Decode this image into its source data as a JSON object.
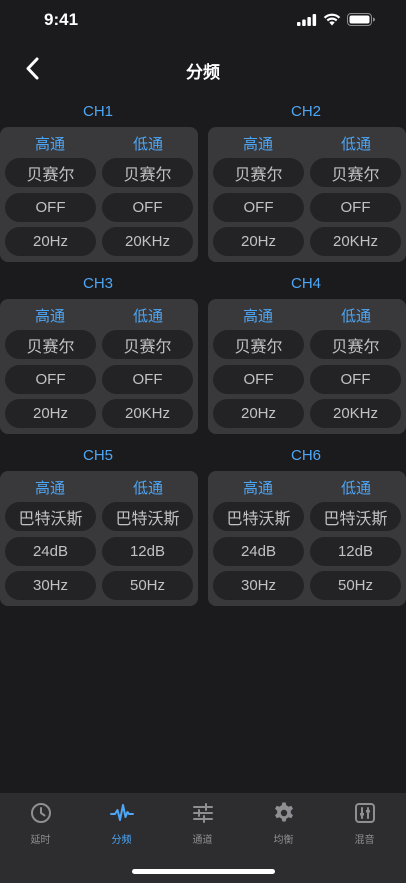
{
  "status": {
    "time": "9:41"
  },
  "header": {
    "title": "分频"
  },
  "columns": {
    "high": "高通",
    "low": "低通"
  },
  "channels": [
    {
      "name": "CH1",
      "high": {
        "type": "贝赛尔",
        "slope": "OFF",
        "freq": "20Hz"
      },
      "low": {
        "type": "贝赛尔",
        "slope": "OFF",
        "freq": "20KHz"
      }
    },
    {
      "name": "CH2",
      "high": {
        "type": "贝赛尔",
        "slope": "OFF",
        "freq": "20Hz"
      },
      "low": {
        "type": "贝赛尔",
        "slope": "OFF",
        "freq": "20KHz"
      }
    },
    {
      "name": "CH3",
      "high": {
        "type": "贝赛尔",
        "slope": "OFF",
        "freq": "20Hz"
      },
      "low": {
        "type": "贝赛尔",
        "slope": "OFF",
        "freq": "20KHz"
      }
    },
    {
      "name": "CH4",
      "high": {
        "type": "贝赛尔",
        "slope": "OFF",
        "freq": "20Hz"
      },
      "low": {
        "type": "贝赛尔",
        "slope": "OFF",
        "freq": "20KHz"
      }
    },
    {
      "name": "CH5",
      "high": {
        "type": "巴特沃斯",
        "slope": "24dB",
        "freq": "30Hz"
      },
      "low": {
        "type": "巴特沃斯",
        "slope": "12dB",
        "freq": "50Hz"
      }
    },
    {
      "name": "CH6",
      "high": {
        "type": "巴特沃斯",
        "slope": "24dB",
        "freq": "30Hz"
      },
      "low": {
        "type": "巴特沃斯",
        "slope": "12dB",
        "freq": "50Hz"
      }
    }
  ],
  "tabs": [
    {
      "label": "延时",
      "icon": "clock-icon",
      "active": false
    },
    {
      "label": "分频",
      "icon": "waveform-icon",
      "active": true
    },
    {
      "label": "通道",
      "icon": "sliders-icon",
      "active": false
    },
    {
      "label": "均衡",
      "icon": "gear-icon",
      "active": false
    },
    {
      "label": "混音",
      "icon": "mixer-icon",
      "active": false
    }
  ],
  "colors": {
    "accent": "#4ea6f5",
    "background": "#1b1b1d",
    "card": "#39393b",
    "pill": "#232325",
    "tabbar": "#2d2d2f"
  }
}
